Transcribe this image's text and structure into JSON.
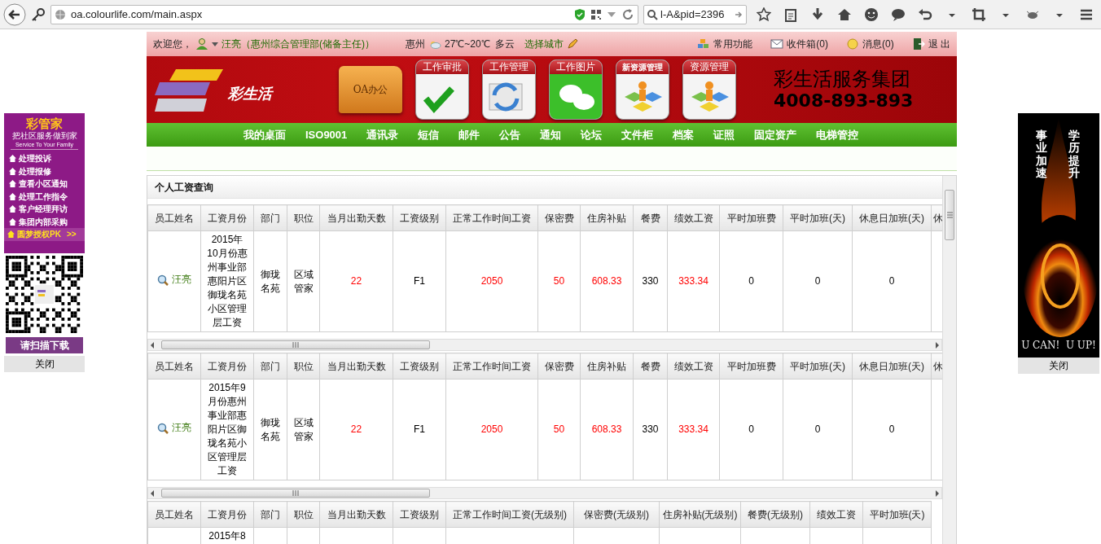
{
  "browser": {
    "url": "oa.colourlife.com/main.aspx",
    "search": "l-A&pid=2396"
  },
  "topbar": {
    "welcome": "欢迎您，",
    "user": "汪亮（惠州综合管理部(储备主任)）",
    "city": "惠州",
    "weather": "27℃~20℃  多云",
    "choose_city": "选择城市",
    "links": [
      "常用功能",
      "收件箱(0)",
      "消息(0)",
      "退 出"
    ]
  },
  "banner": {
    "logo_text": "彩生活",
    "folder": "OA办公",
    "apps": [
      "工作审批",
      "工作管理",
      "工作图片",
      "新资源管理",
      "资源管理"
    ],
    "company": "彩生活服务集团",
    "phone": "4008-893-893"
  },
  "nav": [
    "我的桌面",
    "ISO9001",
    "通讯录",
    "短信",
    "邮件",
    "公告",
    "通知",
    "论坛",
    "文件柜",
    "档案",
    "证照",
    "固定资产",
    "电梯管控"
  ],
  "panel": {
    "title": "个人工资查询",
    "tables": [
      {
        "columns": [
          {
            "label": "员工姓名",
            "highlight": false
          },
          {
            "label": "工资月份",
            "highlight": false
          },
          {
            "label": "部门",
            "highlight": false
          },
          {
            "label": "职位",
            "highlight": false
          },
          {
            "label": "当月出勤天数",
            "highlight": true
          },
          {
            "label": "工资级别",
            "highlight": false
          },
          {
            "label": "正常工作时间工资",
            "highlight": true
          },
          {
            "label": "保密费",
            "highlight": true
          },
          {
            "label": "住房补贴",
            "highlight": true
          },
          {
            "label": "餐费",
            "highlight": false
          },
          {
            "label": "绩效工资",
            "highlight": true
          },
          {
            "label": "平时加班费",
            "highlight": false
          },
          {
            "label": "平时加班(天)",
            "highlight": false
          },
          {
            "label": "休息日加班(天)",
            "highlight": false
          },
          {
            "label": "休"
          }
        ],
        "rows": [
          [
            "汪亮",
            "2015年10月份惠州事业部惠阳片区御珑名苑小区管理层工资",
            "御珑名苑",
            "区域管家",
            "22",
            "F1",
            "2050",
            "50",
            "608.33",
            "330",
            "333.34",
            "0",
            "0",
            "0",
            null
          ]
        ]
      },
      {
        "columns": [
          {
            "label": "员工姓名",
            "highlight": false
          },
          {
            "label": "工资月份",
            "highlight": false
          },
          {
            "label": "部门",
            "highlight": false
          },
          {
            "label": "职位",
            "highlight": false
          },
          {
            "label": "当月出勤天数",
            "highlight": true
          },
          {
            "label": "工资级别",
            "highlight": false
          },
          {
            "label": "正常工作时间工资",
            "highlight": true
          },
          {
            "label": "保密费",
            "highlight": true
          },
          {
            "label": "住房补贴",
            "highlight": true
          },
          {
            "label": "餐费",
            "highlight": false
          },
          {
            "label": "绩效工资",
            "highlight": true
          },
          {
            "label": "平时加班费",
            "highlight": false
          },
          {
            "label": "平时加班(天)",
            "highlight": false
          },
          {
            "label": "休息日加班(天)",
            "highlight": false
          },
          {
            "label": "休"
          }
        ],
        "rows": [
          [
            "汪亮",
            "2015年9月份惠州事业部惠阳片区御珑名苑小区管理层工资",
            "御珑名苑",
            "区域管家",
            "22",
            "F1",
            "2050",
            "50",
            "608.33",
            "330",
            "333.34",
            "0",
            "0",
            "0",
            null
          ]
        ]
      },
      {
        "columns": [
          {
            "label": "员工姓名"
          },
          {
            "label": "工资月份"
          },
          {
            "label": "部门"
          },
          {
            "label": "职位"
          },
          {
            "label": "当月出勤天数"
          },
          {
            "label": "工资级别"
          },
          {
            "label": "正常工作时间工资(无级别)"
          },
          {
            "label": "保密费(无级别)"
          },
          {
            "label": "住房补贴(无级别)"
          },
          {
            "label": "餐费(无级别)"
          },
          {
            "label": "绩效工资"
          },
          {
            "label": "平时加班(天)"
          }
        ],
        "rows": [
          [
            null,
            "2015年8",
            null,
            null,
            null,
            null,
            null,
            null,
            null,
            null,
            null,
            null
          ]
        ]
      }
    ]
  },
  "left_ad": {
    "title": "彩管家",
    "slogan": "把社区服务做到家",
    "slogan_en": "Service To Your Family",
    "items": [
      {
        "label": "处理投诉",
        "featured": false
      },
      {
        "label": "处理报修",
        "featured": false
      },
      {
        "label": "查看小区通知",
        "featured": false
      },
      {
        "label": "处理工作指令",
        "featured": false
      },
      {
        "label": "客户经理拜访",
        "featured": false
      },
      {
        "label": "集团内部采购",
        "featured": false
      },
      {
        "label": "圆梦授权PK",
        "featured": true,
        "suffix": ">>"
      }
    ],
    "download": "请扫描下载",
    "close": "关闭"
  },
  "right_ad": {
    "left_words": "事业加速",
    "right_words": "学历提升",
    "motto": "U CAN!  U UP!",
    "close": "关闭"
  }
}
